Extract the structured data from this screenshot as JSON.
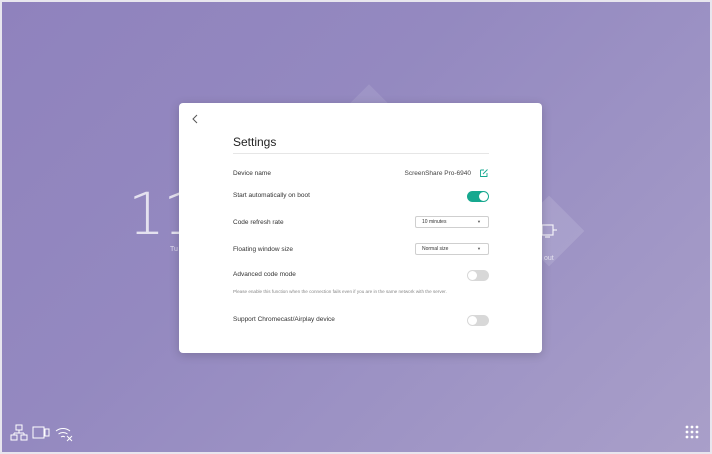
{
  "background": {
    "clock_fragment": "11",
    "left_label": "Tu",
    "right_label": "out"
  },
  "dialog": {
    "title": "Settings",
    "device_name": {
      "label": "Device name",
      "value": "ScreenShare Pro-6940"
    },
    "start_on_boot": {
      "label": "Start automatically on boot",
      "enabled": true
    },
    "code_refresh": {
      "label": "Code refresh rate",
      "selected": "10 minutes"
    },
    "floating_window": {
      "label": "Floating window size",
      "selected": "Normal size"
    },
    "advanced_code": {
      "label": "Advanced code mode",
      "enabled": false,
      "hint": "Please enable this function when the connection fails even if you are in the same network with the server."
    },
    "chromecast": {
      "label": "Support Chromecast/Airplay device",
      "enabled": false
    }
  },
  "colors": {
    "accent": "#16a88f",
    "toggle_off": "#d8d8d8"
  },
  "icons": {
    "back": "chevron-left-icon",
    "edit": "edit-icon",
    "lan": "network-icon",
    "screen": "display-icon",
    "wifi": "wifi-off-icon",
    "apps": "grid-icon"
  }
}
